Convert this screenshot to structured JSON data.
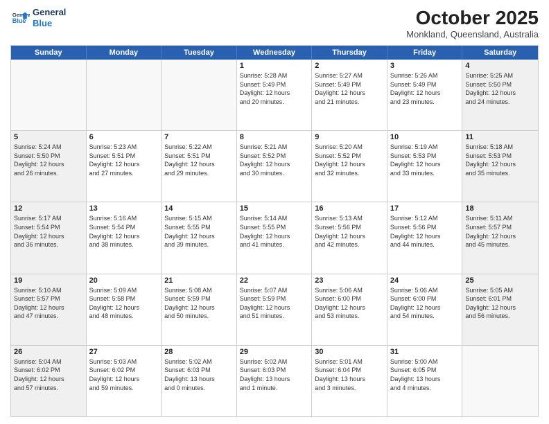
{
  "logo": {
    "line1": "General",
    "line2": "Blue"
  },
  "title": "October 2025",
  "subtitle": "Monkland, Queensland, Australia",
  "weekdays": [
    "Sunday",
    "Monday",
    "Tuesday",
    "Wednesday",
    "Thursday",
    "Friday",
    "Saturday"
  ],
  "weeks": [
    [
      {
        "day": "",
        "text": "",
        "empty": true
      },
      {
        "day": "",
        "text": "",
        "empty": true
      },
      {
        "day": "",
        "text": "",
        "empty": true
      },
      {
        "day": "1",
        "text": "Sunrise: 5:28 AM\nSunset: 5:49 PM\nDaylight: 12 hours\nand 20 minutes."
      },
      {
        "day": "2",
        "text": "Sunrise: 5:27 AM\nSunset: 5:49 PM\nDaylight: 12 hours\nand 21 minutes."
      },
      {
        "day": "3",
        "text": "Sunrise: 5:26 AM\nSunset: 5:49 PM\nDaylight: 12 hours\nand 23 minutes."
      },
      {
        "day": "4",
        "text": "Sunrise: 5:25 AM\nSunset: 5:50 PM\nDaylight: 12 hours\nand 24 minutes."
      }
    ],
    [
      {
        "day": "5",
        "text": "Sunrise: 5:24 AM\nSunset: 5:50 PM\nDaylight: 12 hours\nand 26 minutes."
      },
      {
        "day": "6",
        "text": "Sunrise: 5:23 AM\nSunset: 5:51 PM\nDaylight: 12 hours\nand 27 minutes."
      },
      {
        "day": "7",
        "text": "Sunrise: 5:22 AM\nSunset: 5:51 PM\nDaylight: 12 hours\nand 29 minutes."
      },
      {
        "day": "8",
        "text": "Sunrise: 5:21 AM\nSunset: 5:52 PM\nDaylight: 12 hours\nand 30 minutes."
      },
      {
        "day": "9",
        "text": "Sunrise: 5:20 AM\nSunset: 5:52 PM\nDaylight: 12 hours\nand 32 minutes."
      },
      {
        "day": "10",
        "text": "Sunrise: 5:19 AM\nSunset: 5:53 PM\nDaylight: 12 hours\nand 33 minutes."
      },
      {
        "day": "11",
        "text": "Sunrise: 5:18 AM\nSunset: 5:53 PM\nDaylight: 12 hours\nand 35 minutes."
      }
    ],
    [
      {
        "day": "12",
        "text": "Sunrise: 5:17 AM\nSunset: 5:54 PM\nDaylight: 12 hours\nand 36 minutes."
      },
      {
        "day": "13",
        "text": "Sunrise: 5:16 AM\nSunset: 5:54 PM\nDaylight: 12 hours\nand 38 minutes."
      },
      {
        "day": "14",
        "text": "Sunrise: 5:15 AM\nSunset: 5:55 PM\nDaylight: 12 hours\nand 39 minutes."
      },
      {
        "day": "15",
        "text": "Sunrise: 5:14 AM\nSunset: 5:55 PM\nDaylight: 12 hours\nand 41 minutes."
      },
      {
        "day": "16",
        "text": "Sunrise: 5:13 AM\nSunset: 5:56 PM\nDaylight: 12 hours\nand 42 minutes."
      },
      {
        "day": "17",
        "text": "Sunrise: 5:12 AM\nSunset: 5:56 PM\nDaylight: 12 hours\nand 44 minutes."
      },
      {
        "day": "18",
        "text": "Sunrise: 5:11 AM\nSunset: 5:57 PM\nDaylight: 12 hours\nand 45 minutes."
      }
    ],
    [
      {
        "day": "19",
        "text": "Sunrise: 5:10 AM\nSunset: 5:57 PM\nDaylight: 12 hours\nand 47 minutes."
      },
      {
        "day": "20",
        "text": "Sunrise: 5:09 AM\nSunset: 5:58 PM\nDaylight: 12 hours\nand 48 minutes."
      },
      {
        "day": "21",
        "text": "Sunrise: 5:08 AM\nSunset: 5:59 PM\nDaylight: 12 hours\nand 50 minutes."
      },
      {
        "day": "22",
        "text": "Sunrise: 5:07 AM\nSunset: 5:59 PM\nDaylight: 12 hours\nand 51 minutes."
      },
      {
        "day": "23",
        "text": "Sunrise: 5:06 AM\nSunset: 6:00 PM\nDaylight: 12 hours\nand 53 minutes."
      },
      {
        "day": "24",
        "text": "Sunrise: 5:06 AM\nSunset: 6:00 PM\nDaylight: 12 hours\nand 54 minutes."
      },
      {
        "day": "25",
        "text": "Sunrise: 5:05 AM\nSunset: 6:01 PM\nDaylight: 12 hours\nand 56 minutes."
      }
    ],
    [
      {
        "day": "26",
        "text": "Sunrise: 5:04 AM\nSunset: 6:02 PM\nDaylight: 12 hours\nand 57 minutes."
      },
      {
        "day": "27",
        "text": "Sunrise: 5:03 AM\nSunset: 6:02 PM\nDaylight: 12 hours\nand 59 minutes."
      },
      {
        "day": "28",
        "text": "Sunrise: 5:02 AM\nSunset: 6:03 PM\nDaylight: 13 hours\nand 0 minutes."
      },
      {
        "day": "29",
        "text": "Sunrise: 5:02 AM\nSunset: 6:03 PM\nDaylight: 13 hours\nand 1 minute."
      },
      {
        "day": "30",
        "text": "Sunrise: 5:01 AM\nSunset: 6:04 PM\nDaylight: 13 hours\nand 3 minutes."
      },
      {
        "day": "31",
        "text": "Sunrise: 5:00 AM\nSunset: 6:05 PM\nDaylight: 13 hours\nand 4 minutes."
      },
      {
        "day": "",
        "text": "",
        "empty": true
      }
    ]
  ]
}
